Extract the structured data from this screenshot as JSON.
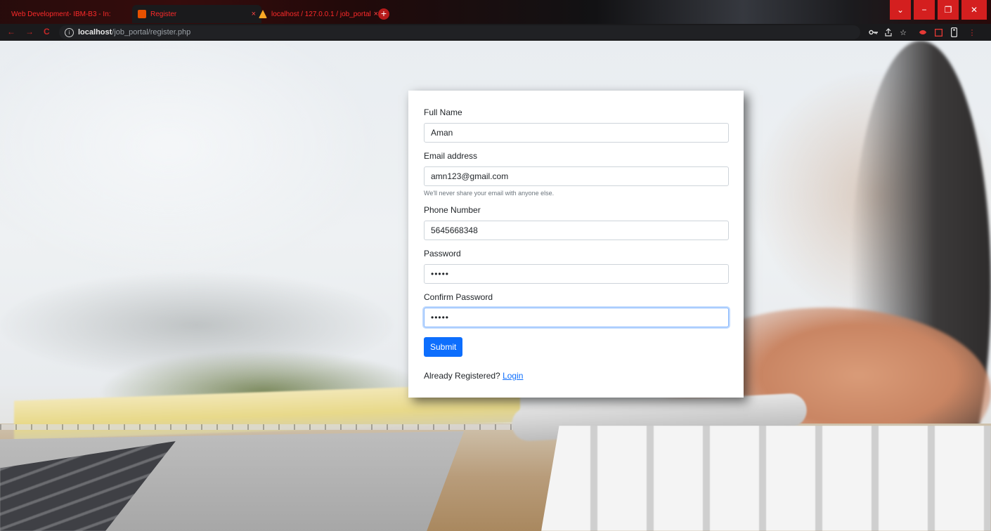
{
  "browser": {
    "tabs": [
      {
        "title": "Web Development- IBM-B3 - In:",
        "close": "×"
      },
      {
        "title": "Register",
        "close": "×"
      },
      {
        "title": "localhost / 127.0.0.1 / job_portal",
        "close": "×"
      }
    ],
    "new_tab": "+",
    "url_host": "localhost",
    "url_path": "/job_portal/register.php",
    "info_glyph": "i",
    "window_controls": {
      "dropdown": "⌄",
      "minimize": "−",
      "restore": "❐",
      "close": "✕"
    },
    "nav": {
      "back": "←",
      "forward": "→",
      "reload": "C"
    },
    "toolbar_icons": [
      "key-icon",
      "share-icon",
      "star-icon",
      "extension-icon",
      "extension-icon",
      "extension-icon",
      "menu-icon"
    ],
    "accent": "#d41f1f"
  },
  "form": {
    "full_name": {
      "label": "Full Name",
      "value": "Aman"
    },
    "email": {
      "label": "Email address",
      "value": "amn123@gmail.com",
      "help": "We'll never share your email with anyone else."
    },
    "phone": {
      "label": "Phone Number",
      "value": "5645668348"
    },
    "password": {
      "label": "Password",
      "value": "•••••"
    },
    "confirm_password": {
      "label": "Confirm Password",
      "value": "•••••"
    },
    "submit_label": "Submit",
    "already_text": "Already Registered?",
    "login_link": "Login",
    "primary_color": "#0d6efd"
  }
}
